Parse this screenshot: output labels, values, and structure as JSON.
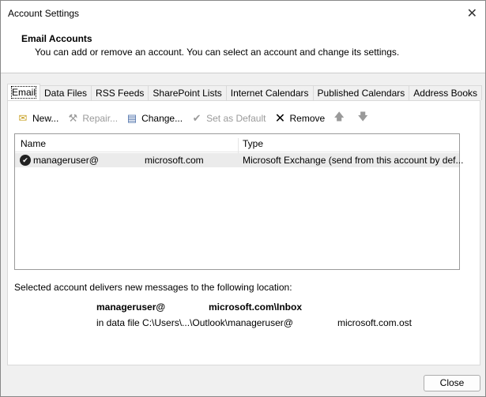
{
  "window": {
    "title": "Account Settings",
    "close_glyph": "✕"
  },
  "header": {
    "title": "Email Accounts",
    "subtitle": "You can add or remove an account. You can select an account and change its settings."
  },
  "tabs": [
    {
      "label": "Email",
      "active": true
    },
    {
      "label": "Data Files"
    },
    {
      "label": "RSS Feeds"
    },
    {
      "label": "SharePoint Lists"
    },
    {
      "label": "Internet Calendars"
    },
    {
      "label": "Published Calendars"
    },
    {
      "label": "Address Books"
    }
  ],
  "toolbar": {
    "new": "New...",
    "repair": "Repair...",
    "change": "Change...",
    "set_default": "Set as Default",
    "remove": "Remove"
  },
  "list": {
    "columns": [
      "Name",
      "Type"
    ],
    "rows": [
      {
        "name_user": "manageruser@",
        "name_domain": "microsoft.com",
        "type": "Microsoft Exchange (send from this account by def..."
      }
    ]
  },
  "location": {
    "label": "Selected account delivers new messages to the following location:",
    "mailbox_user": "manageruser@",
    "mailbox_path": "microsoft.com\\Inbox",
    "file_prefix": "in data file C:\\Users\\...\\Outlook\\manageruser@",
    "file_suffix": "microsoft.com.ost"
  },
  "footer": {
    "close": "Close"
  }
}
